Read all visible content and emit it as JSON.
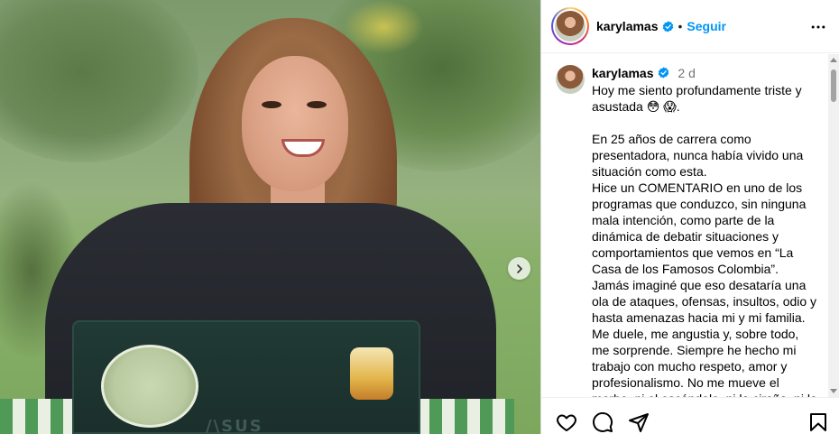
{
  "post": {
    "photo_alt_description_hidden": "",
    "carousel_next_icon": "chevron-right-icon"
  },
  "header": {
    "username": "karylamas",
    "separator": "•",
    "follow_label": "Seguir",
    "more_icon": "more-horizontal-icon"
  },
  "caption": {
    "username": "karylamas",
    "time": "2 d",
    "text": "Hoy me siento profundamente triste y asustada 😳 😱.\n\nEn 25 años de carrera como presentadora, nunca había vivido una situación como esta.\nHice un COMENTARIO en uno de los programas que conduzco, sin ninguna mala intención, como parte de la dinámica de debatir situaciones y comportamientos que vemos en “La Casa de los Famosos Colombia”. Jamás imaginé que eso desataría una ola de ataques, ofensas, insultos, odio y hasta amenazas hacia mi y mi familia.\nMe duele, me angustia y, sobre todo, me sorprende. Siempre he hecho mi trabajo con mucho respeto, amor y profesionalismo. No me mueve el morbo, ni el escándalo, ni la ciraña, ni la"
  },
  "actions": {
    "like_icon": "heart-icon",
    "comment_icon": "comment-icon",
    "share_icon": "share-icon",
    "save_icon": "bookmark-icon"
  },
  "colors": {
    "accent": "#0095f6",
    "verified": "#0095f6",
    "secondary_text": "#737373"
  }
}
